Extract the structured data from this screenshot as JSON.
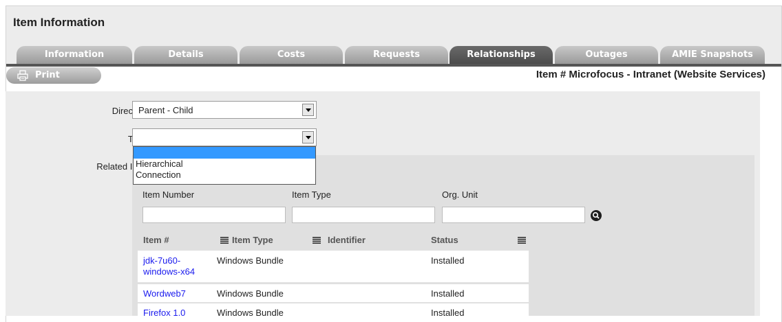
{
  "page": {
    "title": "Item Information"
  },
  "tabs": [
    {
      "label": "Information",
      "active": false
    },
    {
      "label": "Details",
      "active": false
    },
    {
      "label": "Costs",
      "active": false
    },
    {
      "label": "Requests",
      "active": false
    },
    {
      "label": "Relationships",
      "active": true
    },
    {
      "label": "Outages",
      "active": false
    },
    {
      "label": "AMIE Snapshots",
      "active": false
    }
  ],
  "toolbar": {
    "print_label": "Print",
    "print_icon": "printer-icon"
  },
  "item_heading": "Item # Microfocus - Intranet (Website Services)",
  "form": {
    "direction": {
      "label": "Direction",
      "value": "Parent - Child"
    },
    "type": {
      "label": "Type",
      "value": "",
      "options": [
        "",
        "Hierarchical",
        "Connection"
      ]
    },
    "related_item": {
      "label": "Related Item"
    }
  },
  "search": {
    "item_number_label": "Item Number",
    "item_type_label": "Item Type",
    "org_unit_label": "Org. Unit",
    "item_number_value": "",
    "item_type_value": "",
    "org_unit_value": "",
    "search_icon": "magnifier-icon"
  },
  "results": {
    "headers": [
      "Item #",
      "Item Type",
      "Identifier",
      "Status"
    ],
    "rows": [
      {
        "item": "jdk-7u60-windows-x64",
        "item_lines": [
          "jdk-7u60-",
          "windows-x64"
        ],
        "type": "Windows Bundle",
        "identifier": "",
        "status": "Installed"
      },
      {
        "item": "Wordweb7",
        "item_lines": [
          "Wordweb7"
        ],
        "type": "Windows Bundle",
        "identifier": "",
        "status": "Installed"
      },
      {
        "item": "Firefox 1.0",
        "item_lines": [
          "Firefox 1.0"
        ],
        "type": "Windows Bundle",
        "identifier": "",
        "status": "Installed"
      }
    ]
  },
  "colors": {
    "active_tab": "#555555",
    "inactive_tab": "#a8a8a8",
    "link": "#1a1aee",
    "highlight": "#3399ff",
    "panel": "#ececec"
  }
}
